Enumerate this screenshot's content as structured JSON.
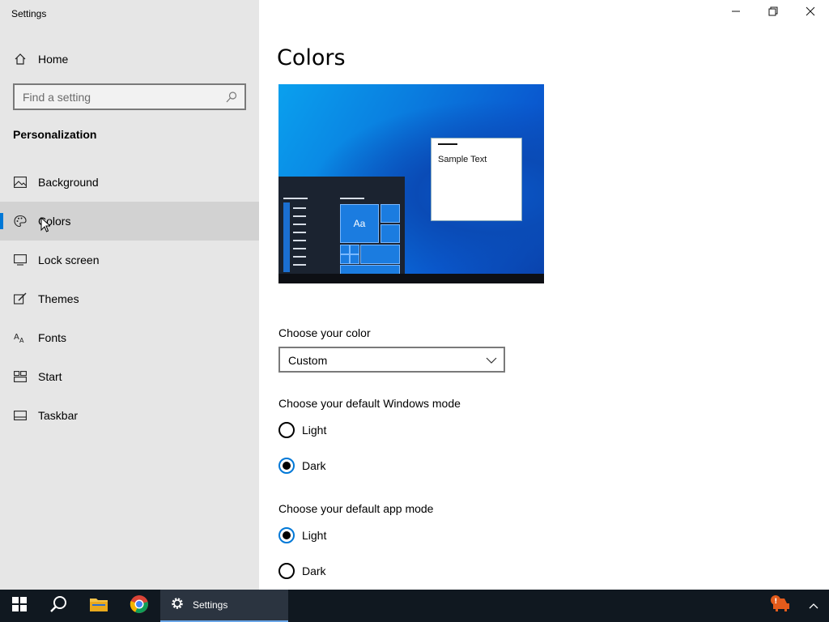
{
  "window": {
    "title": "Settings"
  },
  "sidebar": {
    "home_label": "Home",
    "search_placeholder": "Find a setting",
    "section_title": "Personalization",
    "items": [
      {
        "label": "Background",
        "icon": "image-icon"
      },
      {
        "label": "Colors",
        "icon": "palette-icon",
        "selected": true
      },
      {
        "label": "Lock screen",
        "icon": "lock-screen-icon"
      },
      {
        "label": "Themes",
        "icon": "brush-icon"
      },
      {
        "label": "Fonts",
        "icon": "font-icon"
      },
      {
        "label": "Start",
        "icon": "start-tiles-icon"
      },
      {
        "label": "Taskbar",
        "icon": "taskbar-icon"
      }
    ]
  },
  "main": {
    "title": "Colors",
    "preview": {
      "sample_text": "Sample Text",
      "tile_label": "Aa"
    },
    "choose_color": {
      "label": "Choose your color",
      "value": "Custom"
    },
    "windows_mode": {
      "label": "Choose your default Windows mode",
      "options": [
        "Light",
        "Dark"
      ],
      "selected": "Dark"
    },
    "app_mode": {
      "label": "Choose your default app mode",
      "options": [
        "Light",
        "Dark"
      ],
      "selected": "Light"
    }
  },
  "taskbar": {
    "settings_label": "Settings",
    "accent": "#0078d7"
  }
}
